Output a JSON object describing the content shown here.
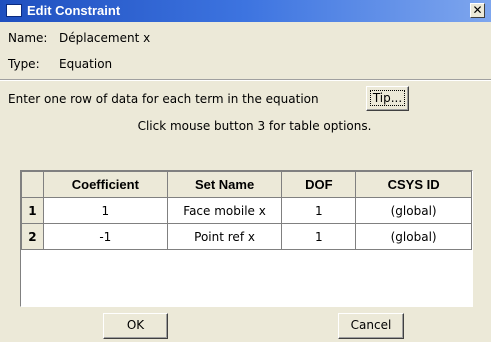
{
  "window": {
    "title": "Edit Constraint",
    "close_glyph": "✕"
  },
  "fields": {
    "name_label": "Name:",
    "name_value": "Déplacement x",
    "type_label": "Type:",
    "type_value": "Equation"
  },
  "instruction": "Enter one row of data for each term in the equation",
  "tip_label": "Tip...",
  "hint": "Click mouse button 3 for table options.",
  "table": {
    "columns": [
      "Coefficient",
      "Set Name",
      "DOF",
      "CSYS ID"
    ],
    "rows": [
      {
        "num": "1",
        "cells": [
          "1",
          "Face mobile x",
          "1",
          "(global)"
        ]
      },
      {
        "num": "2",
        "cells": [
          "-1",
          "Point ref x",
          "1",
          "(global)"
        ]
      }
    ]
  },
  "buttons": {
    "ok": "OK",
    "cancel": "Cancel"
  }
}
